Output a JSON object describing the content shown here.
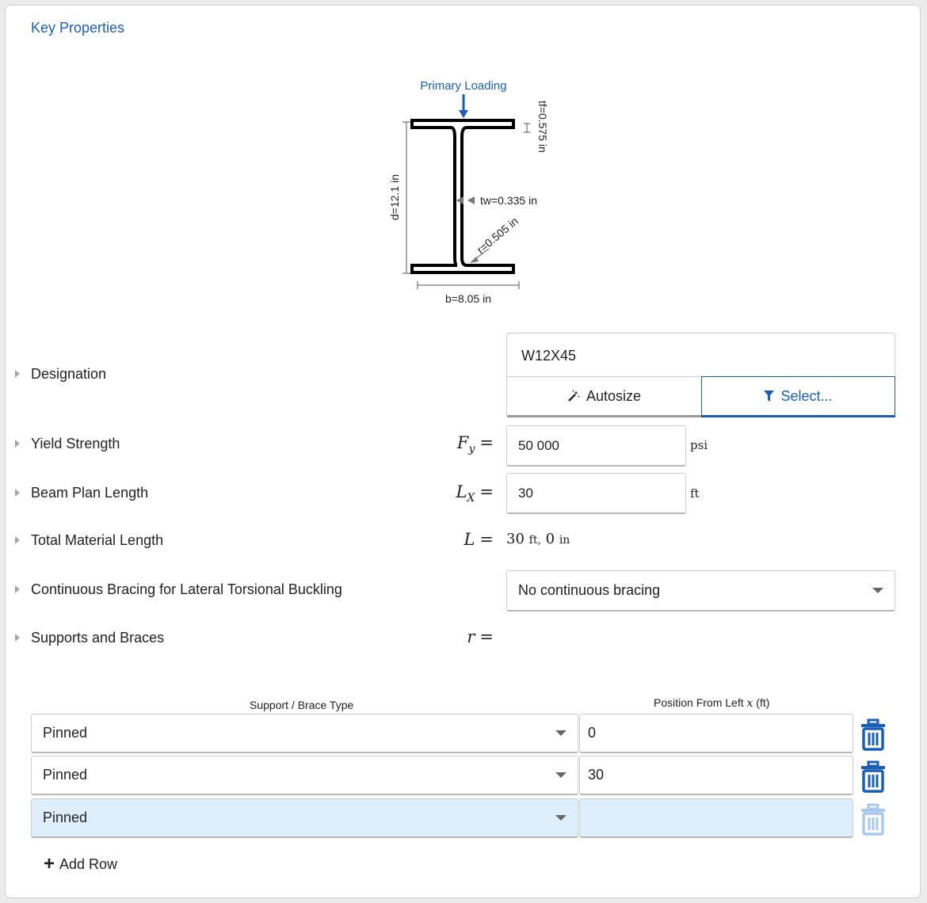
{
  "section": {
    "title": "Key Properties"
  },
  "diagram": {
    "primary_loading": "Primary Loading",
    "tf": "tf=0.575 in",
    "d": "d=12.1 in",
    "tw": "tw=0.335 in",
    "r": "r=0.505 in",
    "b": "b=8.05 in",
    "colors": {
      "accent": "#1a5fb4",
      "shape": "#000000",
      "dimension": "#555555"
    }
  },
  "properties": {
    "designation": {
      "label": "Designation",
      "value": "W12X45",
      "autosize_label": "Autosize",
      "select_label": "Select..."
    },
    "yield_strength": {
      "label": "Yield Strength",
      "symbol": "F",
      "subscript": "y",
      "eq": "=",
      "value": "50 000",
      "unit": "psi"
    },
    "beam_plan_length": {
      "label": "Beam Plan Length",
      "symbol": "L",
      "subscript": "X",
      "eq": "=",
      "value": "30",
      "unit": "ft"
    },
    "total_material_length": {
      "label": "Total Material Length",
      "symbol": "L",
      "eq": "=",
      "value_ft": "30",
      "unit_ft": "ft,",
      "value_in": "0",
      "unit_in": "in"
    },
    "continuous_bracing": {
      "label": "Continuous Bracing for Lateral Torsional Buckling",
      "selected": "No continuous bracing"
    },
    "supports_braces": {
      "label": "Supports and Braces",
      "symbol": "r",
      "eq": "="
    }
  },
  "table": {
    "header_type": "Support / Brace Type",
    "header_position": "Position From Left",
    "header_position_var": "x",
    "header_position_unit": "(ft)",
    "rows": [
      {
        "type": "Pinned",
        "position": "0"
      },
      {
        "type": "Pinned",
        "position": "30"
      },
      {
        "type": "Pinned",
        "position": ""
      }
    ],
    "add_row_label": "Add Row"
  }
}
